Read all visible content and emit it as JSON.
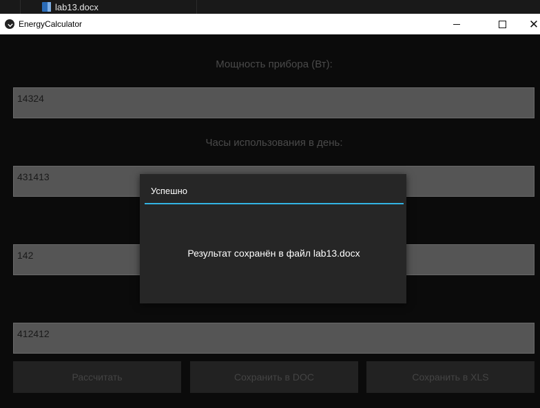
{
  "taskbar": {
    "file_name": "lab13.docx",
    "file_icon": "word-doc-icon"
  },
  "window": {
    "title": "EnergyCalculator",
    "app_icon": "kivy-app-icon",
    "minimize_icon": "minimize-icon",
    "maximize_icon": "maximize-icon",
    "close_icon": "close-icon"
  },
  "form": {
    "power_label": "Мощность прибора (Вт):",
    "power_value": "14324",
    "hours_label": "Часы использования в день:",
    "hours_value": "431413",
    "field3_value": "142",
    "field4_value": "412412"
  },
  "buttons": {
    "calculate": "Рассчитать",
    "save_doc": "Сохранить в DOC",
    "save_xls": "Сохранить в XLS"
  },
  "dialog": {
    "title": "Успешно",
    "message": "Результат сохранён в файл lab13.docx",
    "accent_color": "#33b5e5"
  }
}
